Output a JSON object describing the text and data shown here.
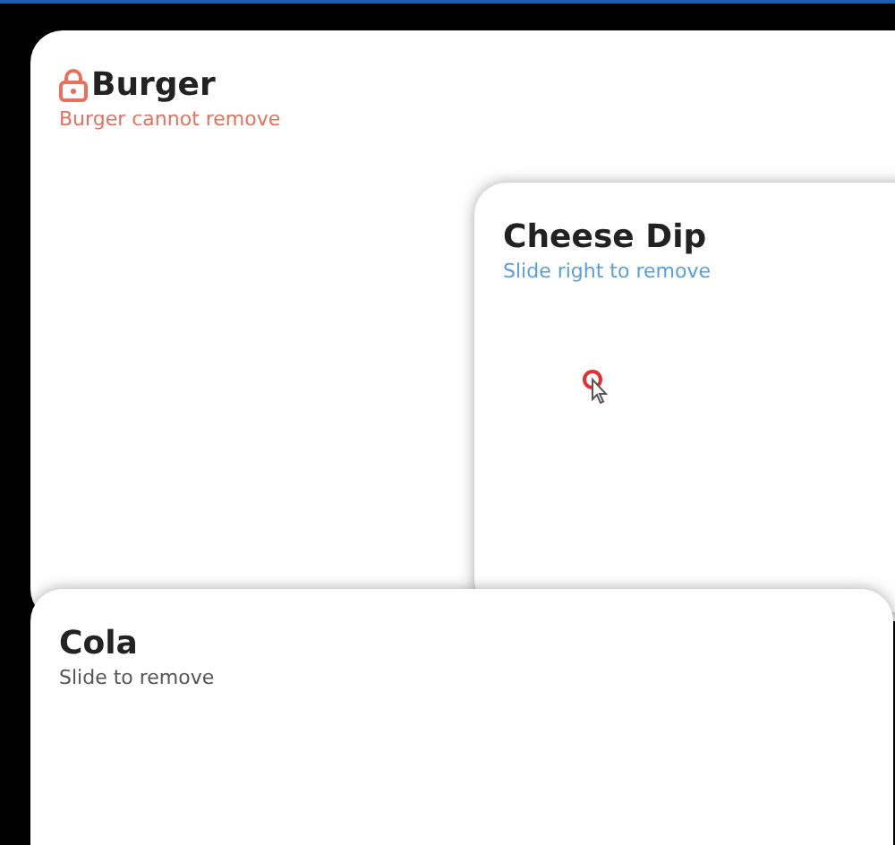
{
  "cards": [
    {
      "title": "Burger",
      "hint": "Burger cannot remove",
      "kind": "locked"
    },
    {
      "title": "Cheese Dip",
      "hint": "Slide right to remove",
      "kind": "swipe-right"
    },
    {
      "title": "Cola",
      "hint": "Slide to remove",
      "kind": "swipe"
    }
  ]
}
